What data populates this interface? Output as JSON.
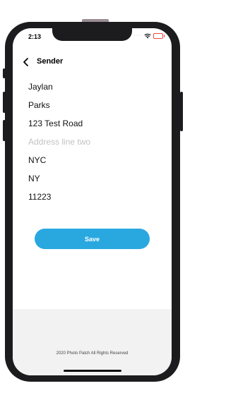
{
  "status_bar": {
    "time": "2:13"
  },
  "nav": {
    "title": "Sender"
  },
  "form": {
    "first_name": "Jaylan",
    "last_name": "Parks",
    "address_line_one": "123 Test Road",
    "address_line_two": "",
    "address_line_two_placeholder": "Address line two",
    "city": "NYC",
    "state": "NY",
    "zip": "11223"
  },
  "save_label": "Save",
  "footer": {
    "text": "2020 Photo Patch All Rights Reserved"
  },
  "colors": {
    "accent": "#29a8e0",
    "battery": "#e74c3c",
    "frame": "#1c1c1e"
  },
  "icons": {
    "back": "chevron-left-icon",
    "wifi": "wifi-icon",
    "battery": "battery-icon"
  }
}
